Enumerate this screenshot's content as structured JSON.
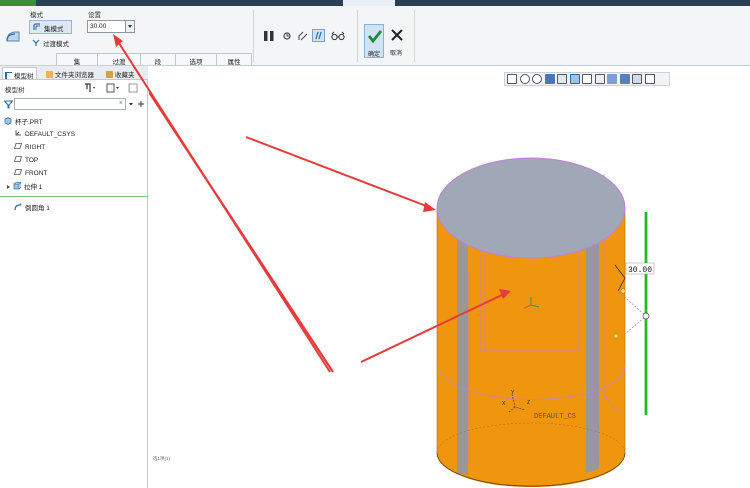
{
  "ribbon": {
    "mode_title": "模式",
    "settings_title": "设置",
    "mode_set_label": "集模式",
    "mode_transition_label": "过渡模式",
    "radius_value": "30.00",
    "subtabs": [
      "集",
      "过渡",
      "段",
      "选项",
      "属性"
    ],
    "ok_label": "确定",
    "cancel_label": "取消"
  },
  "panel": {
    "tabs": [
      "模型树",
      "文件夹浏览器",
      "收藏夹"
    ],
    "tree_title": "模型树",
    "search_placeholder": "",
    "items": [
      {
        "label": "杯子.PRT",
        "icon": "part-icon"
      },
      {
        "label": "DEFAULT_CSYS",
        "icon": "csys-icon"
      },
      {
        "label": "RIGHT",
        "icon": "datum-plane-icon"
      },
      {
        "label": "TOP",
        "icon": "datum-plane-icon"
      },
      {
        "label": "FRONT",
        "icon": "datum-plane-icon"
      },
      {
        "label": "拉伸 1",
        "icon": "extrude-icon"
      },
      {
        "label": "倒圆角 1",
        "icon": "round-icon"
      }
    ]
  },
  "viewport": {
    "dimension_label": "30.00",
    "csys_label": "DEFAULT_CS",
    "axis_x": "X",
    "axis_y": "Y",
    "axis_z": "Z",
    "status_text": "选1项(1)"
  },
  "colors": {
    "cylinder_body": "#f0960e",
    "cylinder_top": "#a0a8b8",
    "selection_edge": "#c080d8",
    "dimension_line": "#22bb22",
    "arrow": "#e53b3b"
  }
}
